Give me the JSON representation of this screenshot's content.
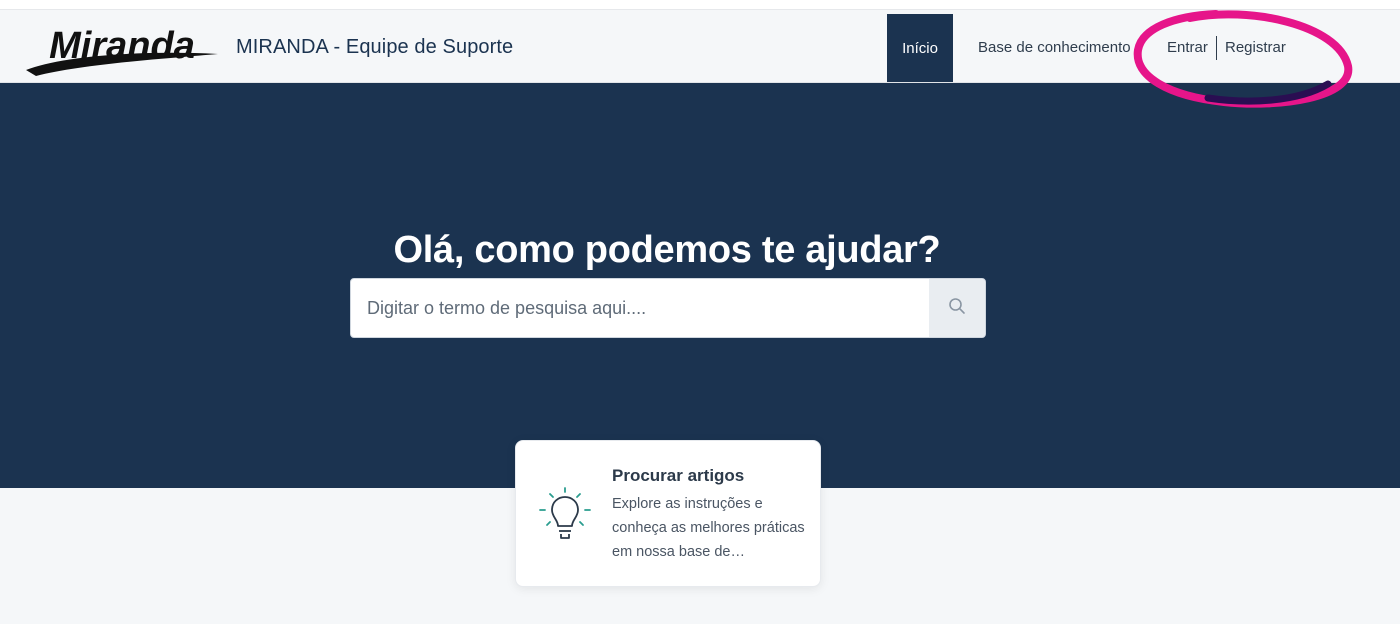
{
  "header": {
    "logo_text": "Miranda",
    "title": "MIRANDA - Equipe de Suporte",
    "nav": {
      "home": "Início",
      "knowledge_base": "Base de conhecimento",
      "login": "Entrar",
      "register": "Registrar"
    }
  },
  "hero": {
    "heading": "Olá, como podemos te ajudar?",
    "search": {
      "placeholder": "Digitar o termo de pesquisa aqui....",
      "icon": "search-icon"
    }
  },
  "cards": [
    {
      "icon": "lightbulb-icon",
      "title": "Procurar artigos",
      "description": "Explore as instruções e conheça as melhores práticas em nossa base de conhecimento."
    }
  ],
  "colors": {
    "primary": "#1b3350",
    "background": "#f5f7f9",
    "accent_teal": "#2a9d8f",
    "annotation": "#e6158a"
  }
}
